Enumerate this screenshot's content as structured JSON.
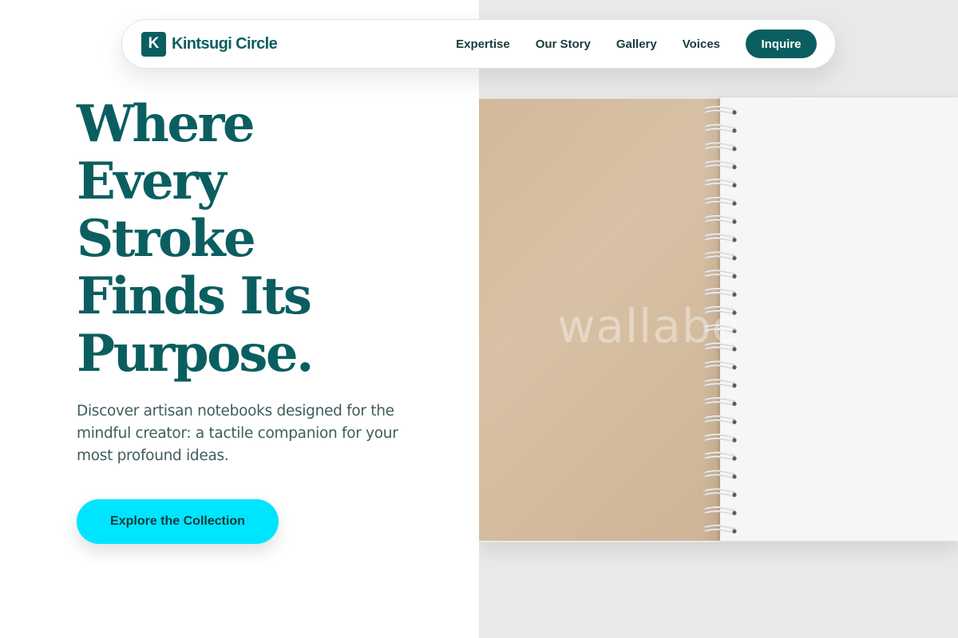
{
  "brand": {
    "logo_letter": "K",
    "name": "Kintsugi Circle"
  },
  "nav": {
    "links": [
      "Expertise",
      "Our Story",
      "Gallery",
      "Voices"
    ],
    "cta_label": "Inquire"
  },
  "hero": {
    "title_lines": [
      "Where",
      "Every",
      "Stroke",
      "Finds Its",
      "Purpose."
    ],
    "subtitle": "Discover artisan notebooks designed for the mindful creator: a tactile companion for your most profound ideas.",
    "cta_label": "Explore the Collection"
  },
  "image": {
    "subject": "spiral-bound notebook with kraft cover",
    "watermark_text": "wallabe"
  },
  "colors": {
    "brand_teal": "#0b5e60",
    "cta_cyan": "#00e5ff",
    "body_text": "#3f5c5d",
    "kraft": "#d3b99a"
  }
}
